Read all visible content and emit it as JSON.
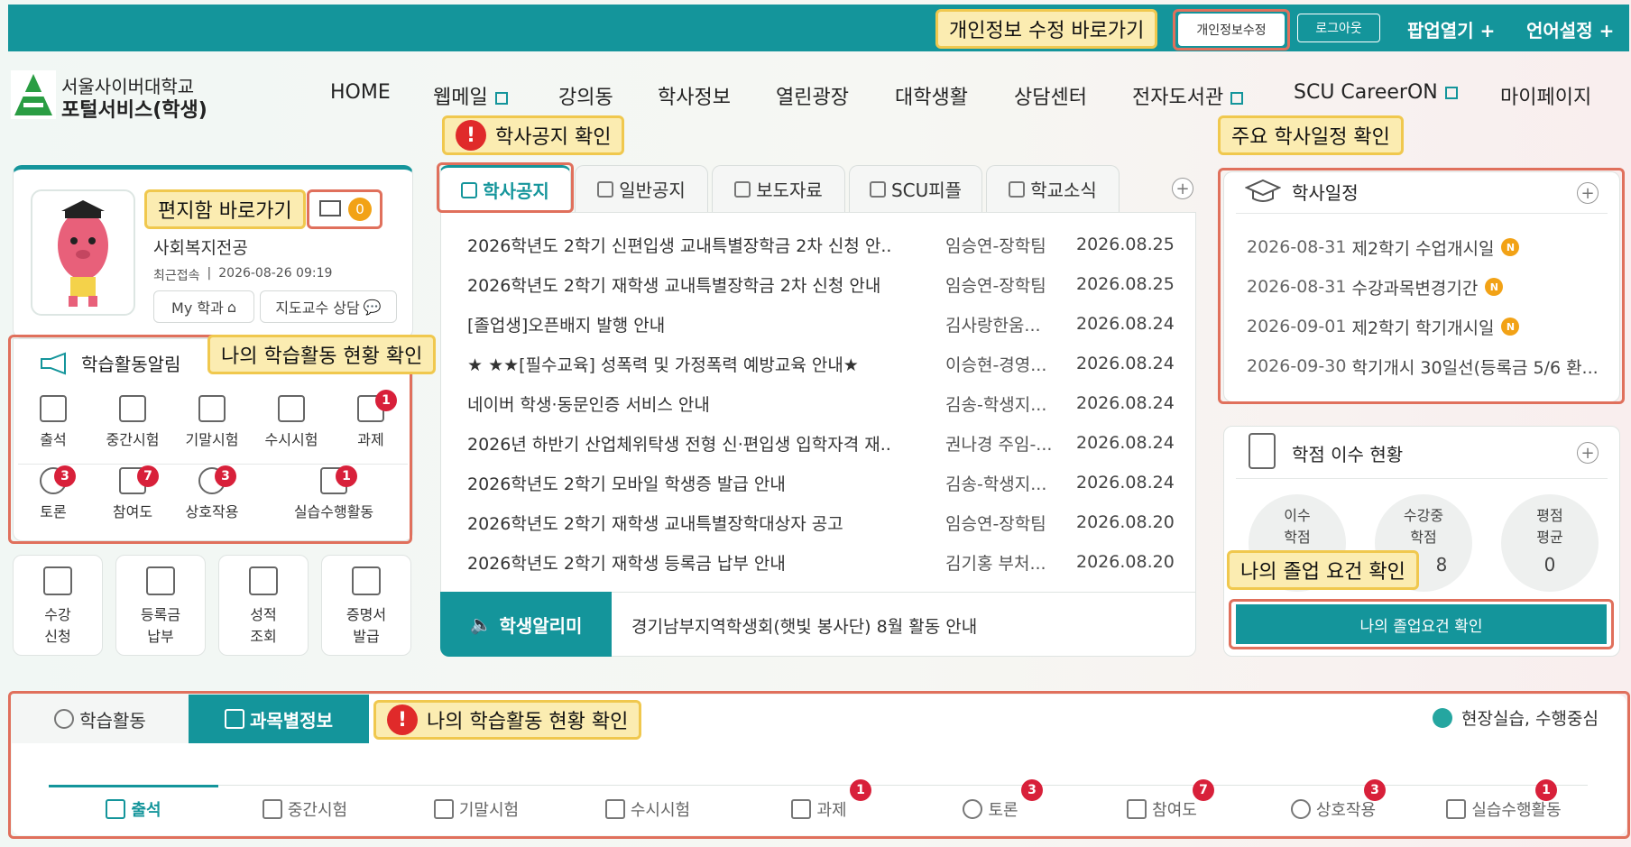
{
  "topbar": {
    "callout": "개인정보 수정 바로가기",
    "profile_edit": "개인정보수정",
    "logout": "로그아웃",
    "popup": "팝업열기 +",
    "language": "언어설정 +"
  },
  "logo": {
    "line1": "서울사이버대학교",
    "line2": "포털서비스(학생)"
  },
  "nav": [
    "HOME",
    "웹메일",
    "강의동",
    "학사정보",
    "열린광장",
    "대학생활",
    "상담센터",
    "전자도서관",
    "SCU CareerON",
    "마이페이지"
  ],
  "callouts": {
    "notice": "학사공지 확인",
    "schedule": "주요 학사일정 확인",
    "mailbox": "편지함 바로가기",
    "activity": "나의 학습활동 현황 확인",
    "graduation": "나의 졸업 요건 확인",
    "bottom_activity": "나의 학습활동 현황 확인"
  },
  "profile": {
    "dept": "사회복지전공",
    "last_login_label": "최근접속",
    "last_login": "2026-08-26 09:19",
    "mail_count": "0",
    "my_dept": "My 학과",
    "advisor": "지도교수 상담"
  },
  "activity": {
    "title": "학습활동알림",
    "items": [
      {
        "label": "출석",
        "badge": ""
      },
      {
        "label": "중간시험",
        "badge": ""
      },
      {
        "label": "기말시험",
        "badge": ""
      },
      {
        "label": "수시시험",
        "badge": ""
      },
      {
        "label": "과제",
        "badge": "1"
      },
      {
        "label": "토론",
        "badge": "3"
      },
      {
        "label": "참여도",
        "badge": "7"
      },
      {
        "label": "상호작용",
        "badge": "3"
      },
      {
        "label": "실습수행활동",
        "badge": "1"
      }
    ]
  },
  "quick": [
    {
      "l1": "수강",
      "l2": "신청"
    },
    {
      "l1": "등록금",
      "l2": "납부"
    },
    {
      "l1": "성적",
      "l2": "조회"
    },
    {
      "l1": "증명서",
      "l2": "발급"
    }
  ],
  "tabs": [
    "학사공지",
    "일반공지",
    "보도자료",
    "SCU피플",
    "학교소식"
  ],
  "notices": [
    {
      "title": "2026학년도 2학기 신편입생 교내특별장학금 2차 신청 안..",
      "writer": "임승연-장학팀",
      "date": "2026.08.25"
    },
    {
      "title": "2026학년도 2학기 재학생 교내특별장학금 2차 신청 안내",
      "writer": "임승연-장학팀",
      "date": "2026.08.25"
    },
    {
      "title": "[졸업생]오픈배지 발행 안내",
      "writer": "김사랑한움...",
      "date": "2026.08.24"
    },
    {
      "title": "★ ★★[필수교육] 성폭력 및 가정폭력 예방교육 안내★",
      "writer": "이승현-경영...",
      "date": "2026.08.24"
    },
    {
      "title": "네이버 학생·동문인증 서비스 안내",
      "writer": "김송-학생지...",
      "date": "2026.08.24"
    },
    {
      "title": "2026년 하반기 산업체위탁생 전형 신·편입생 입학자격 재..",
      "writer": "권나경 주임-...",
      "date": "2026.08.24"
    },
    {
      "title": "2026학년도 2학기 모바일 학생증 발급 안내",
      "writer": "김송-학생지...",
      "date": "2026.08.24"
    },
    {
      "title": "2026학년도 2학기 재학생 교내특별장학대상자 공고",
      "writer": "임승연-장학팀",
      "date": "2026.08.20"
    },
    {
      "title": "2026학년도 2학기 재학생 등록금 납부 안내",
      "writer": "김기홍 부처...",
      "date": "2026.08.20"
    }
  ],
  "alimi": {
    "label": "학생알리미",
    "text": "경기남부지역학생회(햇빛 봉사단) 8월 활동 안내"
  },
  "schedule": {
    "title": "학사일정",
    "items": [
      {
        "date": "2026-08-31",
        "text": "제2학기 수업개시일",
        "badge": "N"
      },
      {
        "date": "2026-08-31",
        "text": "수강과목변경기간",
        "badge": "N"
      },
      {
        "date": "2026-09-01",
        "text": "제2학기 학기개시일",
        "badge": "N"
      },
      {
        "date": "2026-09-30",
        "text": "학기개시 30일선(등록금 5/6 환...",
        "badge": ""
      }
    ]
  },
  "credits": {
    "title": "학점 이수 현황",
    "c1a": "이수",
    "c1b": "학점",
    "c2a": "수강중",
    "c2b": "학점",
    "c2v": "8",
    "c3a": "평점",
    "c3b": "평균",
    "c3v": "0",
    "button": "나의 졸업요건 확인"
  },
  "bottom": {
    "tab1": "학습활동",
    "tab2": "과목별정보",
    "right_label": "현장실습, 수행중심",
    "items": [
      {
        "label": "출석",
        "badge": ""
      },
      {
        "label": "중간시험",
        "badge": ""
      },
      {
        "label": "기말시험",
        "badge": ""
      },
      {
        "label": "수시시험",
        "badge": ""
      },
      {
        "label": "과제",
        "badge": "1"
      },
      {
        "label": "토론",
        "badge": "3"
      },
      {
        "label": "참여도",
        "badge": "7"
      },
      {
        "label": "상호작용",
        "badge": "3"
      },
      {
        "label": "실습수행활동",
        "badge": "1"
      }
    ]
  },
  "colors": {
    "teal": "#14959b",
    "highlight": "#e0705c",
    "callout": "#fbecb1",
    "badge": "#d8203a"
  }
}
